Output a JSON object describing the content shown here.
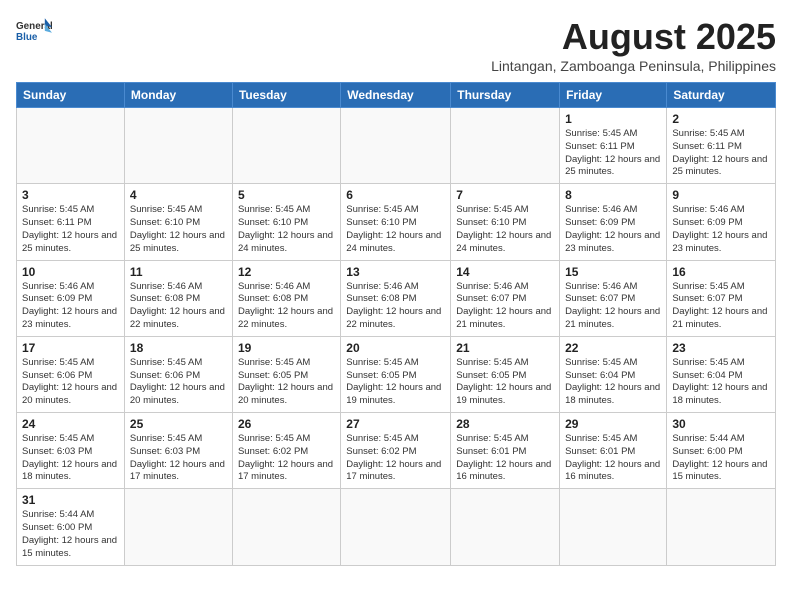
{
  "header": {
    "logo_general": "General",
    "logo_blue": "Blue",
    "month_title": "August 2025",
    "location": "Lintangan, Zamboanga Peninsula, Philippines"
  },
  "weekdays": [
    "Sunday",
    "Monday",
    "Tuesday",
    "Wednesday",
    "Thursday",
    "Friday",
    "Saturday"
  ],
  "weeks": [
    [
      {
        "day": "",
        "content": ""
      },
      {
        "day": "",
        "content": ""
      },
      {
        "day": "",
        "content": ""
      },
      {
        "day": "",
        "content": ""
      },
      {
        "day": "",
        "content": ""
      },
      {
        "day": "1",
        "content": "Sunrise: 5:45 AM\nSunset: 6:11 PM\nDaylight: 12 hours and 25 minutes."
      },
      {
        "day": "2",
        "content": "Sunrise: 5:45 AM\nSunset: 6:11 PM\nDaylight: 12 hours and 25 minutes."
      }
    ],
    [
      {
        "day": "3",
        "content": "Sunrise: 5:45 AM\nSunset: 6:11 PM\nDaylight: 12 hours and 25 minutes."
      },
      {
        "day": "4",
        "content": "Sunrise: 5:45 AM\nSunset: 6:10 PM\nDaylight: 12 hours and 25 minutes."
      },
      {
        "day": "5",
        "content": "Sunrise: 5:45 AM\nSunset: 6:10 PM\nDaylight: 12 hours and 24 minutes."
      },
      {
        "day": "6",
        "content": "Sunrise: 5:45 AM\nSunset: 6:10 PM\nDaylight: 12 hours and 24 minutes."
      },
      {
        "day": "7",
        "content": "Sunrise: 5:45 AM\nSunset: 6:10 PM\nDaylight: 12 hours and 24 minutes."
      },
      {
        "day": "8",
        "content": "Sunrise: 5:46 AM\nSunset: 6:09 PM\nDaylight: 12 hours and 23 minutes."
      },
      {
        "day": "9",
        "content": "Sunrise: 5:46 AM\nSunset: 6:09 PM\nDaylight: 12 hours and 23 minutes."
      }
    ],
    [
      {
        "day": "10",
        "content": "Sunrise: 5:46 AM\nSunset: 6:09 PM\nDaylight: 12 hours and 23 minutes."
      },
      {
        "day": "11",
        "content": "Sunrise: 5:46 AM\nSunset: 6:08 PM\nDaylight: 12 hours and 22 minutes."
      },
      {
        "day": "12",
        "content": "Sunrise: 5:46 AM\nSunset: 6:08 PM\nDaylight: 12 hours and 22 minutes."
      },
      {
        "day": "13",
        "content": "Sunrise: 5:46 AM\nSunset: 6:08 PM\nDaylight: 12 hours and 22 minutes."
      },
      {
        "day": "14",
        "content": "Sunrise: 5:46 AM\nSunset: 6:07 PM\nDaylight: 12 hours and 21 minutes."
      },
      {
        "day": "15",
        "content": "Sunrise: 5:46 AM\nSunset: 6:07 PM\nDaylight: 12 hours and 21 minutes."
      },
      {
        "day": "16",
        "content": "Sunrise: 5:45 AM\nSunset: 6:07 PM\nDaylight: 12 hours and 21 minutes."
      }
    ],
    [
      {
        "day": "17",
        "content": "Sunrise: 5:45 AM\nSunset: 6:06 PM\nDaylight: 12 hours and 20 minutes."
      },
      {
        "day": "18",
        "content": "Sunrise: 5:45 AM\nSunset: 6:06 PM\nDaylight: 12 hours and 20 minutes."
      },
      {
        "day": "19",
        "content": "Sunrise: 5:45 AM\nSunset: 6:05 PM\nDaylight: 12 hours and 20 minutes."
      },
      {
        "day": "20",
        "content": "Sunrise: 5:45 AM\nSunset: 6:05 PM\nDaylight: 12 hours and 19 minutes."
      },
      {
        "day": "21",
        "content": "Sunrise: 5:45 AM\nSunset: 6:05 PM\nDaylight: 12 hours and 19 minutes."
      },
      {
        "day": "22",
        "content": "Sunrise: 5:45 AM\nSunset: 6:04 PM\nDaylight: 12 hours and 18 minutes."
      },
      {
        "day": "23",
        "content": "Sunrise: 5:45 AM\nSunset: 6:04 PM\nDaylight: 12 hours and 18 minutes."
      }
    ],
    [
      {
        "day": "24",
        "content": "Sunrise: 5:45 AM\nSunset: 6:03 PM\nDaylight: 12 hours and 18 minutes."
      },
      {
        "day": "25",
        "content": "Sunrise: 5:45 AM\nSunset: 6:03 PM\nDaylight: 12 hours and 17 minutes."
      },
      {
        "day": "26",
        "content": "Sunrise: 5:45 AM\nSunset: 6:02 PM\nDaylight: 12 hours and 17 minutes."
      },
      {
        "day": "27",
        "content": "Sunrise: 5:45 AM\nSunset: 6:02 PM\nDaylight: 12 hours and 17 minutes."
      },
      {
        "day": "28",
        "content": "Sunrise: 5:45 AM\nSunset: 6:01 PM\nDaylight: 12 hours and 16 minutes."
      },
      {
        "day": "29",
        "content": "Sunrise: 5:45 AM\nSunset: 6:01 PM\nDaylight: 12 hours and 16 minutes."
      },
      {
        "day": "30",
        "content": "Sunrise: 5:44 AM\nSunset: 6:00 PM\nDaylight: 12 hours and 15 minutes."
      }
    ],
    [
      {
        "day": "31",
        "content": "Sunrise: 5:44 AM\nSunset: 6:00 PM\nDaylight: 12 hours and 15 minutes."
      },
      {
        "day": "",
        "content": ""
      },
      {
        "day": "",
        "content": ""
      },
      {
        "day": "",
        "content": ""
      },
      {
        "day": "",
        "content": ""
      },
      {
        "day": "",
        "content": ""
      },
      {
        "day": "",
        "content": ""
      }
    ]
  ]
}
